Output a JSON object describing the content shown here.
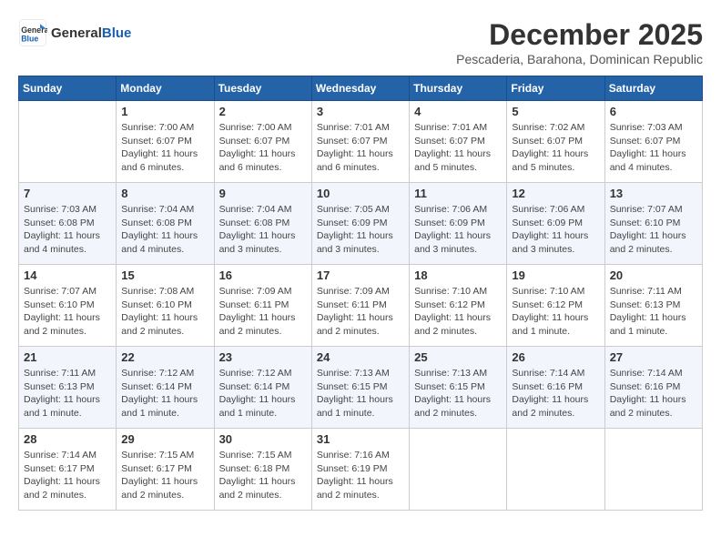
{
  "header": {
    "logo_line1": "General",
    "logo_line2": "Blue",
    "month": "December 2025",
    "location": "Pescaderia, Barahona, Dominican Republic"
  },
  "days_of_week": [
    "Sunday",
    "Monday",
    "Tuesday",
    "Wednesday",
    "Thursday",
    "Friday",
    "Saturday"
  ],
  "weeks": [
    [
      {
        "day": "",
        "info": ""
      },
      {
        "day": "1",
        "info": "Sunrise: 7:00 AM\nSunset: 6:07 PM\nDaylight: 11 hours and 6 minutes."
      },
      {
        "day": "2",
        "info": "Sunrise: 7:00 AM\nSunset: 6:07 PM\nDaylight: 11 hours and 6 minutes."
      },
      {
        "day": "3",
        "info": "Sunrise: 7:01 AM\nSunset: 6:07 PM\nDaylight: 11 hours and 6 minutes."
      },
      {
        "day": "4",
        "info": "Sunrise: 7:01 AM\nSunset: 6:07 PM\nDaylight: 11 hours and 5 minutes."
      },
      {
        "day": "5",
        "info": "Sunrise: 7:02 AM\nSunset: 6:07 PM\nDaylight: 11 hours and 5 minutes."
      },
      {
        "day": "6",
        "info": "Sunrise: 7:03 AM\nSunset: 6:07 PM\nDaylight: 11 hours and 4 minutes."
      }
    ],
    [
      {
        "day": "7",
        "info": "Sunrise: 7:03 AM\nSunset: 6:08 PM\nDaylight: 11 hours and 4 minutes."
      },
      {
        "day": "8",
        "info": "Sunrise: 7:04 AM\nSunset: 6:08 PM\nDaylight: 11 hours and 4 minutes."
      },
      {
        "day": "9",
        "info": "Sunrise: 7:04 AM\nSunset: 6:08 PM\nDaylight: 11 hours and 3 minutes."
      },
      {
        "day": "10",
        "info": "Sunrise: 7:05 AM\nSunset: 6:09 PM\nDaylight: 11 hours and 3 minutes."
      },
      {
        "day": "11",
        "info": "Sunrise: 7:06 AM\nSunset: 6:09 PM\nDaylight: 11 hours and 3 minutes."
      },
      {
        "day": "12",
        "info": "Sunrise: 7:06 AM\nSunset: 6:09 PM\nDaylight: 11 hours and 3 minutes."
      },
      {
        "day": "13",
        "info": "Sunrise: 7:07 AM\nSunset: 6:10 PM\nDaylight: 11 hours and 2 minutes."
      }
    ],
    [
      {
        "day": "14",
        "info": "Sunrise: 7:07 AM\nSunset: 6:10 PM\nDaylight: 11 hours and 2 minutes."
      },
      {
        "day": "15",
        "info": "Sunrise: 7:08 AM\nSunset: 6:10 PM\nDaylight: 11 hours and 2 minutes."
      },
      {
        "day": "16",
        "info": "Sunrise: 7:09 AM\nSunset: 6:11 PM\nDaylight: 11 hours and 2 minutes."
      },
      {
        "day": "17",
        "info": "Sunrise: 7:09 AM\nSunset: 6:11 PM\nDaylight: 11 hours and 2 minutes."
      },
      {
        "day": "18",
        "info": "Sunrise: 7:10 AM\nSunset: 6:12 PM\nDaylight: 11 hours and 2 minutes."
      },
      {
        "day": "19",
        "info": "Sunrise: 7:10 AM\nSunset: 6:12 PM\nDaylight: 11 hours and 1 minute."
      },
      {
        "day": "20",
        "info": "Sunrise: 7:11 AM\nSunset: 6:13 PM\nDaylight: 11 hours and 1 minute."
      }
    ],
    [
      {
        "day": "21",
        "info": "Sunrise: 7:11 AM\nSunset: 6:13 PM\nDaylight: 11 hours and 1 minute."
      },
      {
        "day": "22",
        "info": "Sunrise: 7:12 AM\nSunset: 6:14 PM\nDaylight: 11 hours and 1 minute."
      },
      {
        "day": "23",
        "info": "Sunrise: 7:12 AM\nSunset: 6:14 PM\nDaylight: 11 hours and 1 minute."
      },
      {
        "day": "24",
        "info": "Sunrise: 7:13 AM\nSunset: 6:15 PM\nDaylight: 11 hours and 1 minute."
      },
      {
        "day": "25",
        "info": "Sunrise: 7:13 AM\nSunset: 6:15 PM\nDaylight: 11 hours and 2 minutes."
      },
      {
        "day": "26",
        "info": "Sunrise: 7:14 AM\nSunset: 6:16 PM\nDaylight: 11 hours and 2 minutes."
      },
      {
        "day": "27",
        "info": "Sunrise: 7:14 AM\nSunset: 6:16 PM\nDaylight: 11 hours and 2 minutes."
      }
    ],
    [
      {
        "day": "28",
        "info": "Sunrise: 7:14 AM\nSunset: 6:17 PM\nDaylight: 11 hours and 2 minutes."
      },
      {
        "day": "29",
        "info": "Sunrise: 7:15 AM\nSunset: 6:17 PM\nDaylight: 11 hours and 2 minutes."
      },
      {
        "day": "30",
        "info": "Sunrise: 7:15 AM\nSunset: 6:18 PM\nDaylight: 11 hours and 2 minutes."
      },
      {
        "day": "31",
        "info": "Sunrise: 7:16 AM\nSunset: 6:19 PM\nDaylight: 11 hours and 2 minutes."
      },
      {
        "day": "",
        "info": ""
      },
      {
        "day": "",
        "info": ""
      },
      {
        "day": "",
        "info": ""
      }
    ]
  ]
}
